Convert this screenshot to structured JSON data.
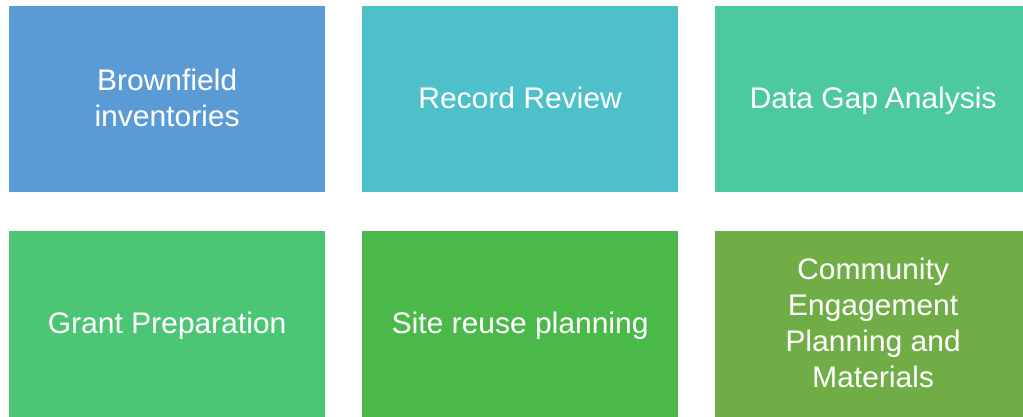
{
  "tiles": [
    {
      "label": "Brownfield\ninventories",
      "color": "#5b9bd5"
    },
    {
      "label": "Record Review",
      "color": "#4ec0c9"
    },
    {
      "label": "Data Gap Analysis",
      "color": "#4dc9a2"
    },
    {
      "label": "Grant Preparation",
      "color": "#4cc575"
    },
    {
      "label": "Site reuse planning",
      "color": "#4ab94a"
    },
    {
      "label": "Community\nEngagement\nPlanning and\nMaterials",
      "color": "#70ad47"
    }
  ]
}
